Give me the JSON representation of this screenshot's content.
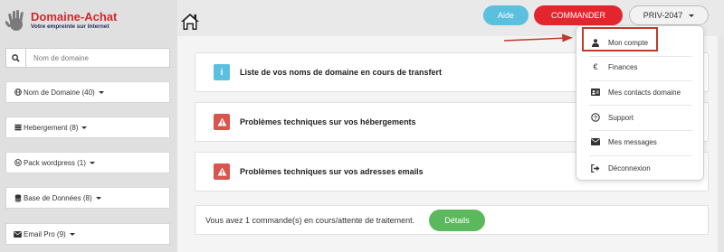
{
  "brand": {
    "name": "Domaine-Achat",
    "tagline": "Votre empreinte sur Internet"
  },
  "search": {
    "placeholder": "Nom de domaine",
    "icon": "search-icon"
  },
  "sidebar": {
    "items": [
      {
        "label": "Nom de Domaine (40)",
        "icon": "globe-icon"
      },
      {
        "label": "Hebergement (8)",
        "icon": "server-icon"
      },
      {
        "label": "Pack wordpress (1)",
        "icon": "wordpress-icon"
      },
      {
        "label": "Base de Données (8)",
        "icon": "database-icon"
      },
      {
        "label": "Email Pro (9)",
        "icon": "envelope-icon"
      }
    ]
  },
  "header": {
    "help_label": "Aide",
    "order_label": "COMMANDER",
    "account_label": "PRIV-2047"
  },
  "panels": [
    {
      "text": "Liste de vos noms de domaine en cours de transfert",
      "type": "info",
      "icon": "info-icon"
    },
    {
      "text": "Problèmes techniques sur vos hébergements",
      "type": "warning",
      "icon": "warning-icon"
    },
    {
      "text": "Problèmes techniques sur vos adresses emails",
      "type": "warning",
      "icon": "warning-icon"
    }
  ],
  "orders": {
    "message": "Vous avez 1 commande(s) en cours/attente de traitement.",
    "details_label": "Détails"
  },
  "account_menu": {
    "items": [
      {
        "label": "Mon compte",
        "icon": "user-icon"
      },
      {
        "label": "Finances",
        "icon": "euro-icon"
      },
      {
        "label": "Mes contacts domaine",
        "icon": "id-card-icon"
      },
      {
        "label": "Support",
        "icon": "question-icon"
      },
      {
        "label": "Mes messages",
        "icon": "envelope-icon"
      },
      {
        "label": "Déconnexion",
        "icon": "sign-out-icon"
      }
    ]
  },
  "colors": {
    "brand_red": "#d9252b",
    "help_button": "#5bc0de",
    "order_button": "#e3262d",
    "details_button": "#5cb85c",
    "warning_badge": "#d9534f",
    "info_badge": "#5bc0de",
    "highlight_box": "#c0392b"
  }
}
